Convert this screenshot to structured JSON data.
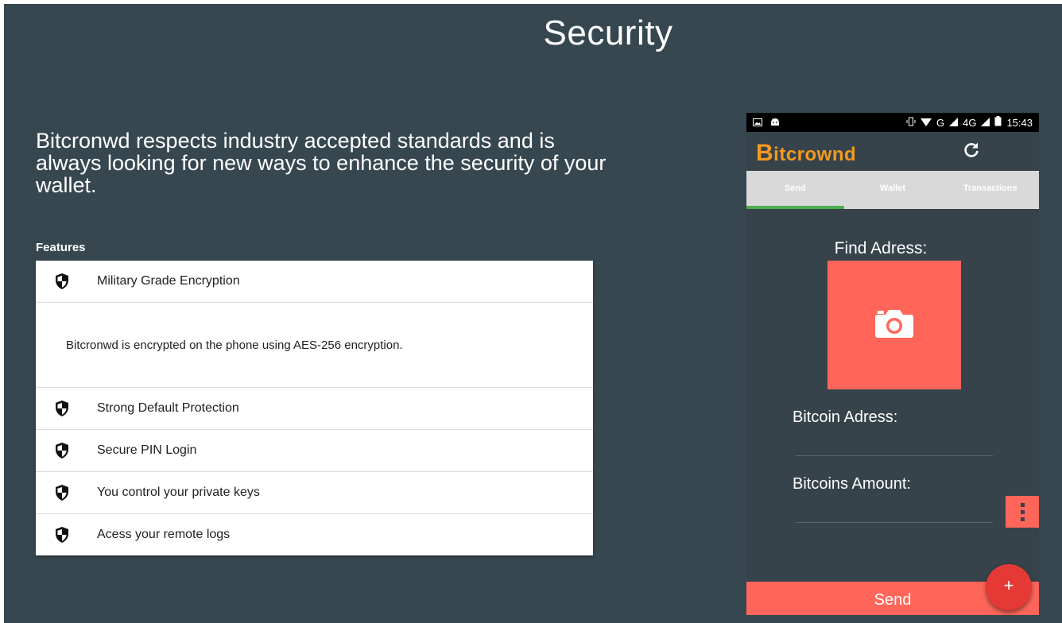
{
  "page": {
    "title": "Security",
    "intro": "Bitcronwd respects industry accepted standards and is always looking for new ways to enhance the security of your wallet.",
    "features_title": "Features"
  },
  "features": {
    "items": [
      {
        "label": "Military Grade Encryption",
        "icon": "shield-icon",
        "expanded": true
      },
      {
        "label": "Strong Default Protection",
        "icon": "shield-icon"
      },
      {
        "label": "Secure PIN Login",
        "icon": "shield-icon"
      },
      {
        "label": "You control your private keys",
        "icon": "shield-icon"
      },
      {
        "label": "Acess your remote logs",
        "icon": "shield-icon"
      }
    ],
    "expanded_body": "Bitcronwd is encrypted on the phone using AES-256 encryption."
  },
  "phone": {
    "status_bar": {
      "time": "15:43",
      "network_1": "G",
      "network_2": "4G",
      "left_icons": [
        "image-icon",
        "android-icon"
      ]
    },
    "app": {
      "brand_first": "B",
      "brand_rest": "itcrownd",
      "brand_color": "#f39a1f",
      "refresh_icon": "refresh-icon"
    },
    "tabs": [
      {
        "label": "Send",
        "active": true
      },
      {
        "label": "Wallet"
      },
      {
        "label": "Transactions"
      }
    ],
    "send_form": {
      "find_label": "Find Adress:",
      "camera_icon": "camera-icon",
      "bitcoin_address_label": "Bitcoin Adress:",
      "bitcoin_address_value": "",
      "amount_label": "Bitcoins Amount:",
      "amount_value": "",
      "send_label": "Send",
      "fab_label": "+"
    }
  },
  "colors": {
    "background": "#37474f",
    "accent": "#ff6659",
    "tab_indicator": "#4caf50",
    "fab": "#e53935"
  }
}
